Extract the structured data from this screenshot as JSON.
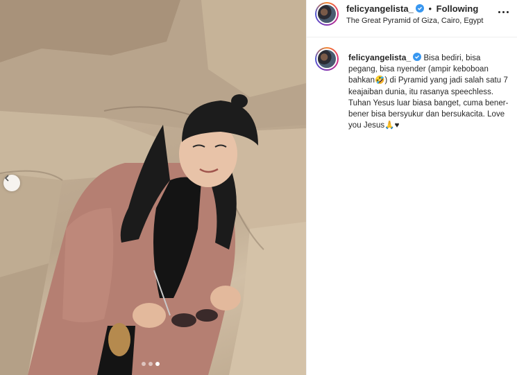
{
  "post": {
    "username": "felicyangelista_",
    "verified_icon": "verified-badge-icon",
    "separator": "•",
    "follow_status": "Following",
    "location": "The Great Pyramid of Giza, Cairo, Egypt",
    "more_icon": "more-options-icon",
    "caption": "Bisa bediri, bisa pegang, bisa nyender (ampir keboboan bahkan🤣) di Pyramid yang jadi salah satu 7 keajaiban dunia, itu rasanya speechless. Tuhan Yesus luar biasa banget, cuma bener-bener bisa bersyukur dan bersukacita. Love you Jesus🙏♥"
  },
  "carousel": {
    "prev_icon": "chevron-left-icon",
    "slide_count": 3,
    "active_slide": 3
  },
  "colors": {
    "verified_blue": "#3897f0",
    "text": "#262626",
    "divider": "#efefef"
  }
}
